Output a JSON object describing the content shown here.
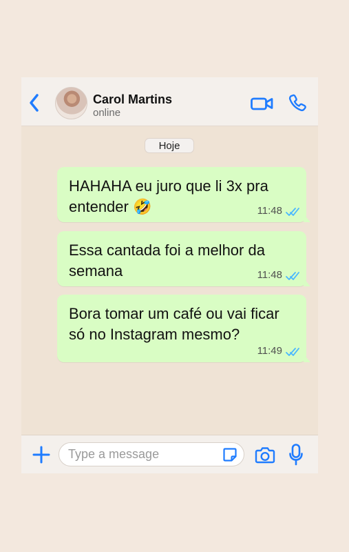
{
  "chat": {
    "contact_name": "Carol Martins",
    "status": "online",
    "date_label": "Hoje",
    "messages": [
      {
        "text": "HAHAHA eu juro que li 3x pra entender 🤣",
        "time": "11:48",
        "status_icon": "double-check-icon"
      },
      {
        "text": "Essa cantada foi a melhor da semana",
        "time": "11:48",
        "status_icon": "double-check-icon"
      },
      {
        "text": "Bora tomar um café ou vai ficar só no Instagram mesmo?",
        "time": "11:49",
        "status_icon": "double-check-icon"
      }
    ]
  },
  "composer": {
    "placeholder": "Type a message"
  },
  "icons": {
    "back": "chevron-left-icon",
    "video": "video-camera-icon",
    "phone": "phone-icon",
    "add": "plus-icon",
    "sticker": "sticker-icon",
    "camera": "camera-icon",
    "mic": "microphone-icon"
  },
  "colors": {
    "accent": "#1f7cff",
    "incoming_background": "#efe3d5",
    "outgoing_bubble": "#d9fdc4",
    "read_check": "#49b7ff",
    "page_background": "#f3e8de"
  }
}
